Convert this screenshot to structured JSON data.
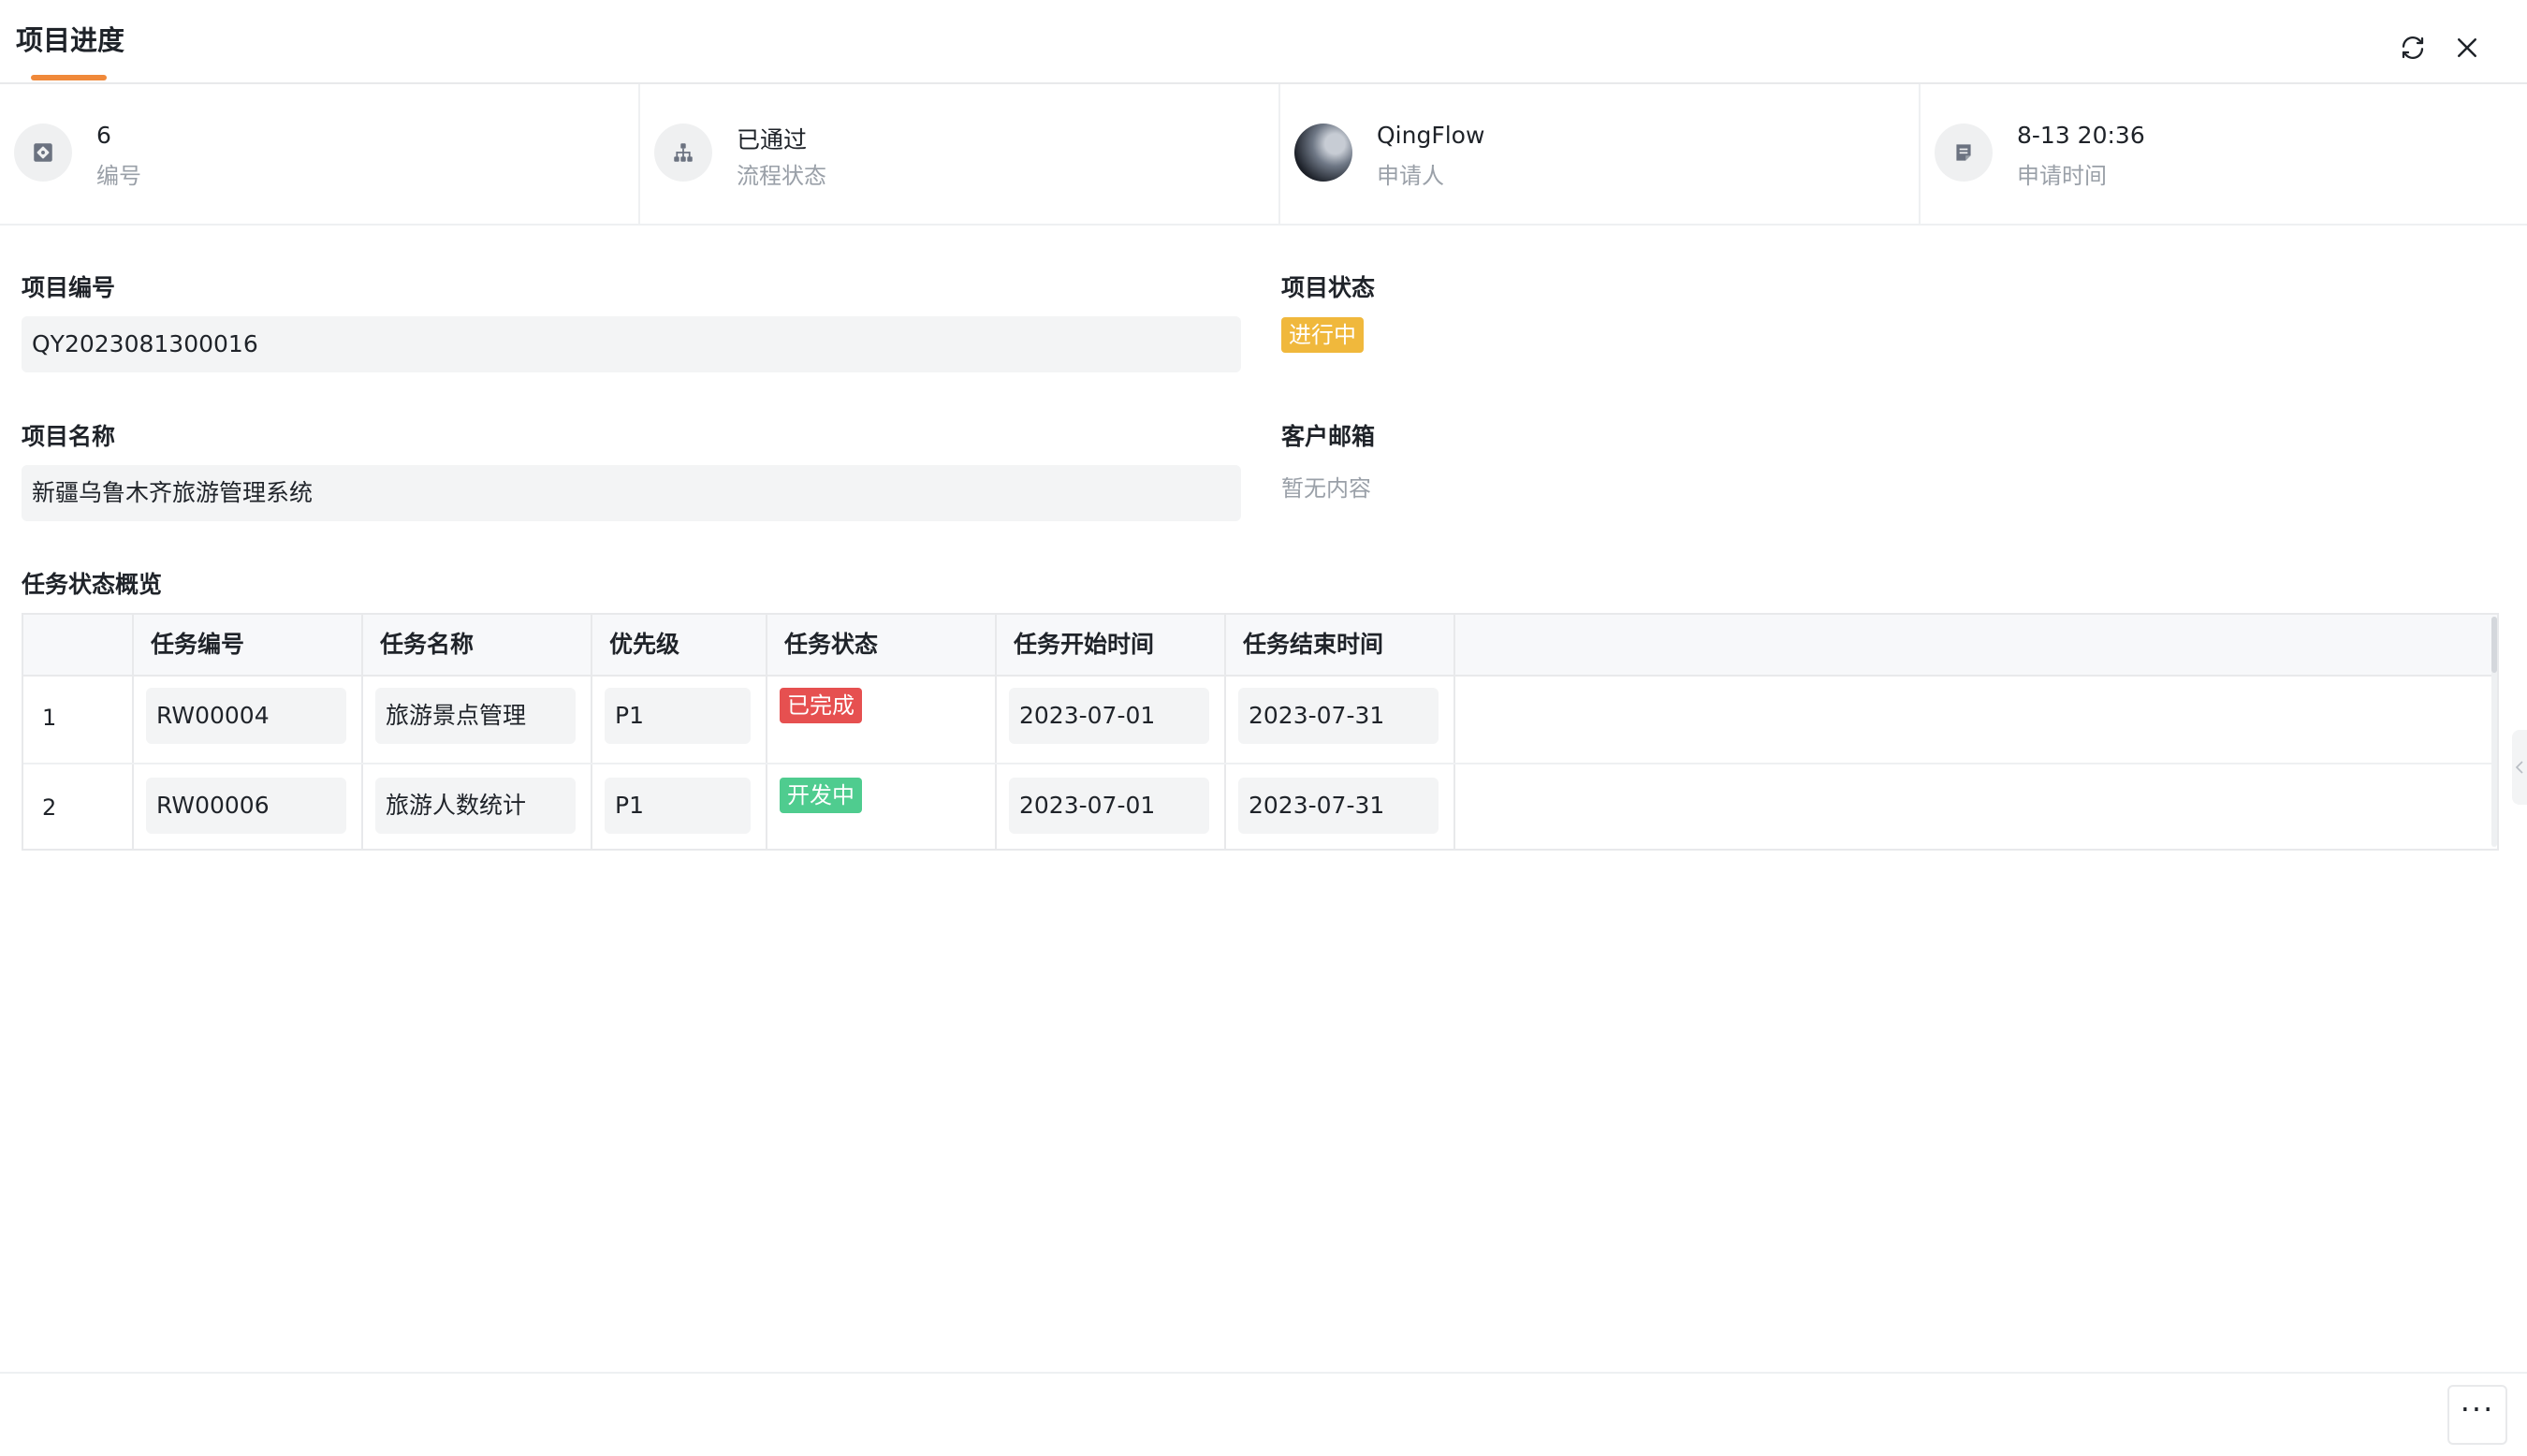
{
  "header": {
    "title": "项目进度",
    "refresh_icon": "refresh-icon",
    "close_icon": "close-icon"
  },
  "info": [
    {
      "value": "6",
      "label": "编号",
      "icon": "id-card-icon"
    },
    {
      "value": "已通过",
      "label": "流程状态",
      "icon": "flow-chart-icon"
    },
    {
      "value": "QingFlow",
      "label": "申请人",
      "icon": "avatar"
    },
    {
      "value": "8-13 20:36",
      "label": "申请时间",
      "icon": "document-icon"
    }
  ],
  "form": {
    "project_no_label": "项目编号",
    "project_no_value": "QY2023081300016",
    "project_status_label": "项目状态",
    "project_status_value": "进行中",
    "project_name_label": "项目名称",
    "project_name_value": "新疆乌鲁木齐旅游管理系统",
    "customer_email_label": "客户邮箱",
    "customer_email_value": "暂无内容"
  },
  "table": {
    "title": "任务状态概览",
    "columns": [
      "任务编号",
      "任务名称",
      "优先级",
      "任务状态",
      "任务开始时间",
      "任务结束时间"
    ],
    "rows": [
      {
        "index": "1",
        "task_no": "RW00004",
        "task_name": "旅游景点管理",
        "priority": "P1",
        "status": "已完成",
        "status_color": "#e65050",
        "start": "2023-07-01",
        "end": "2023-07-31"
      },
      {
        "index": "2",
        "task_no": "RW00006",
        "task_name": "旅游人数统计",
        "priority": "P1",
        "status": "开发中",
        "status_color": "#4fcc8f",
        "start": "2023-07-01",
        "end": "2023-07-31"
      }
    ]
  },
  "colors": {
    "accent": "#f0893a",
    "status_in_progress": "#f0b83c"
  },
  "footer": {
    "more_label": "···"
  }
}
